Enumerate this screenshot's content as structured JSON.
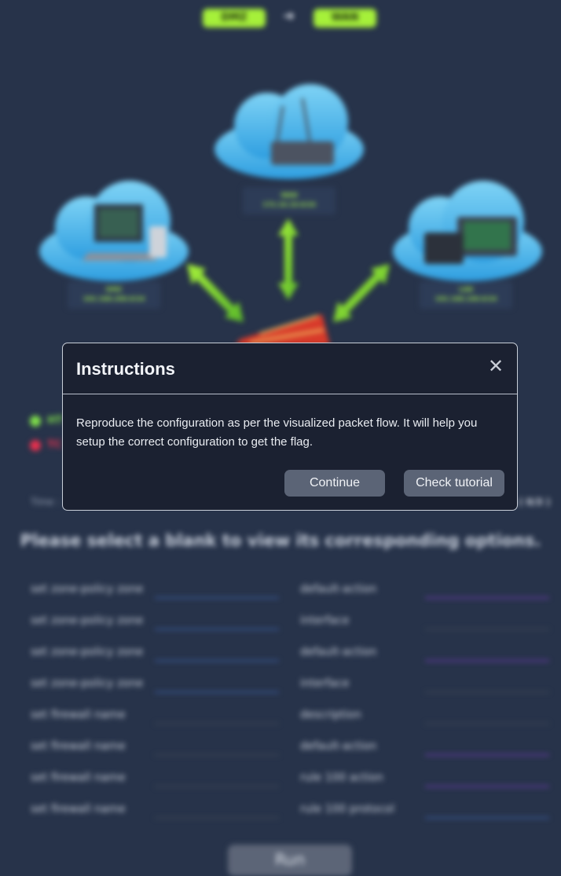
{
  "flow": {
    "source": "DMZ",
    "destination": "WAN"
  },
  "network": {
    "wan_label": "WAN",
    "wan_subnet": "172.16.10.0/24",
    "dmz_label": "DMZ",
    "dmz_subnet": "192.168.200.0/24",
    "lan_label": "LAN",
    "lan_subnet": "192.168.100.0/24"
  },
  "colors": {
    "accent_green": "#a6f03a",
    "legend_green": "#7fe04a",
    "legend_red": "#e8304e",
    "background": "#27334a"
  },
  "legend": {
    "item1_text": "HT",
    "item2_text": "TC"
  },
  "timer": {
    "label": "Time :",
    "progress": "( 0/3 )"
  },
  "prompt": "Please select a blank to view its corresponding options.",
  "config_rows": [
    {
      "command": "set zone-policy zone",
      "param": "default-action"
    },
    {
      "command": "set zone-policy zone",
      "param": "interface"
    },
    {
      "command": "set zone-policy zone",
      "param": "default-action"
    },
    {
      "command": "set zone-policy zone",
      "param": "interface"
    },
    {
      "command": "set firewall name",
      "param": "description"
    },
    {
      "command": "set firewall name",
      "param": "default-action"
    },
    {
      "command": "set firewall name",
      "param": "rule 100 action"
    },
    {
      "command": "set firewall name",
      "param": "rule 100 protocol"
    }
  ],
  "run_label": "Run",
  "modal": {
    "title": "Instructions",
    "body": "Reproduce the configuration as per the visualized packet flow. It will help you setup the correct configuration to get the flag.",
    "continue_label": "Continue",
    "tutorial_label": "Check tutorial",
    "close_icon": "close-icon"
  }
}
